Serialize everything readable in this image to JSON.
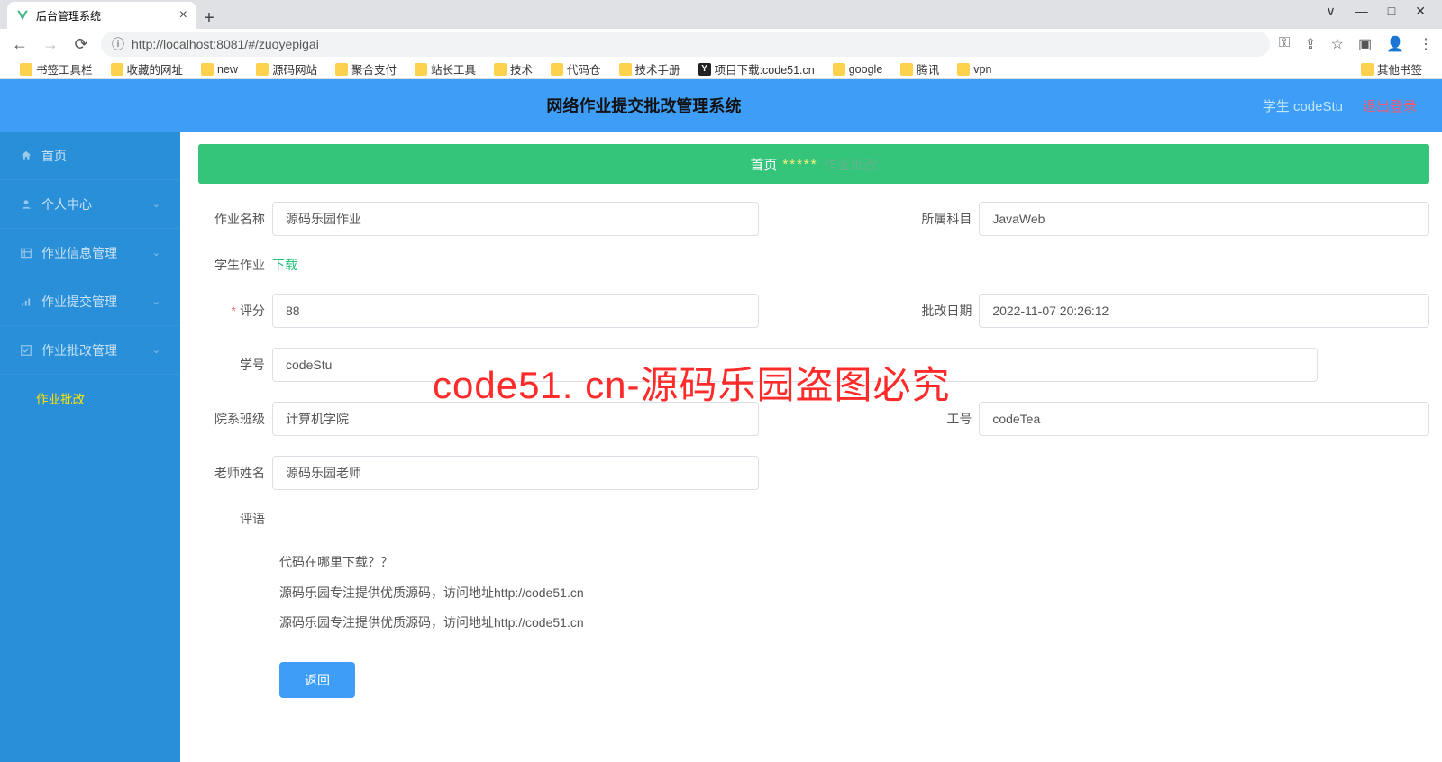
{
  "browser": {
    "tab_title": "后台管理系统",
    "url": "http://localhost:8081/#/zuoyepigai",
    "bookmarks": [
      "书签工具栏",
      "收藏的网址",
      "new",
      "源码网站",
      "聚合支付",
      "站长工具",
      "技术",
      "代码仓",
      "技术手册",
      "项目下载:code51.cn",
      "google",
      "腾讯",
      "vpn"
    ],
    "bookmarks_other": "其他书签"
  },
  "header": {
    "title": "网络作业提交批改管理系统",
    "user_role": "学生",
    "user_name": "codeStu",
    "logout": "退出登录"
  },
  "sidebar": {
    "items": [
      {
        "label": "首页"
      },
      {
        "label": "个人中心"
      },
      {
        "label": "作业信息管理"
      },
      {
        "label": "作业提交管理"
      },
      {
        "label": "作业批改管理"
      }
    ],
    "active_sub": "作业批改"
  },
  "crumb": {
    "home": "首页",
    "sep": "*****",
    "current": "作业批改"
  },
  "form": {
    "name_label": "作业名称",
    "name_value": "源码乐园作业",
    "subject_label": "所属科目",
    "subject_value": "JavaWeb",
    "file_label": "学生作业",
    "download": "下载",
    "score_label": "评分",
    "score_value": "88",
    "date_label": "批改日期",
    "date_value": "2022-11-07 20:26:12",
    "sid_label": "学号",
    "sid_value": "codeStu",
    "dept_label": "院系班级",
    "dept_value": "计算机学院",
    "tid_label": "工号",
    "tid_value": "codeTea",
    "tname_label": "老师姓名",
    "tname_value": "源码乐园老师",
    "comment_label": "评语",
    "comment_lines": [
      "代码在哪里下载？？",
      "源码乐园专注提供优质源码，访问地址http://code51.cn",
      "源码乐园专注提供优质源码，访问地址http://code51.cn"
    ],
    "back_btn": "返回"
  },
  "watermark": "code51. cn-源码乐园盗图必究"
}
